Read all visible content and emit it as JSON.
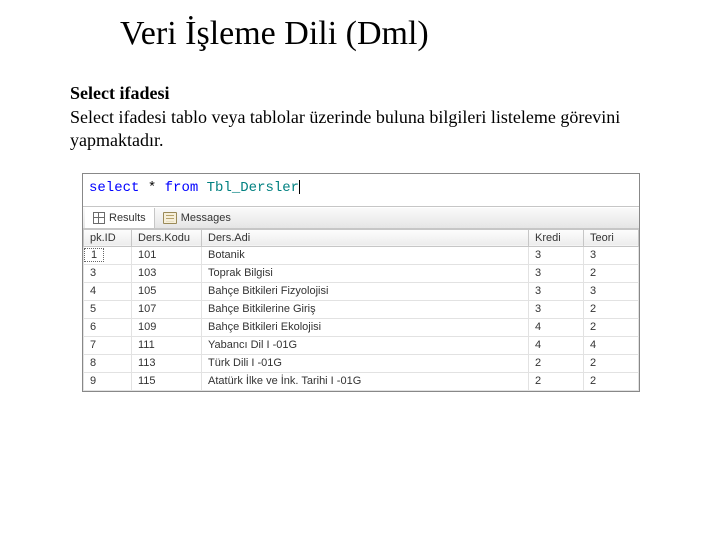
{
  "title": "Veri İşleme Dili (Dml)",
  "subtitle": "Select ifadesi",
  "body": "Select ifadesi tablo veya tablolar üzerinde buluna bilgileri listeleme görevini yapmaktadır.",
  "sql": {
    "kw_select": "select",
    "star": " * ",
    "kw_from": "from",
    "sp": " ",
    "table": "Tbl_Dersler"
  },
  "tabs": {
    "results": "Results",
    "messages": "Messages"
  },
  "columns": [
    "pk.ID",
    "Ders.Kodu",
    "Ders.Adi",
    "Kredi",
    "Teori"
  ],
  "rows": [
    {
      "id": "1",
      "kodu": "101",
      "adi": "Botanik",
      "kredi": "3",
      "teori": "3"
    },
    {
      "id": "3",
      "kodu": "103",
      "adi": "Toprak Bilgisi",
      "kredi": "3",
      "teori": "2"
    },
    {
      "id": "4",
      "kodu": "105",
      "adi": "Bahçe Bitkileri Fizyolojisi",
      "kredi": "3",
      "teori": "3"
    },
    {
      "id": "5",
      "kodu": "107",
      "adi": "Bahçe Bitkilerine Giriş",
      "kredi": "3",
      "teori": "2"
    },
    {
      "id": "6",
      "kodu": "109",
      "adi": "Bahçe Bitkileri Ekolojisi",
      "kredi": "4",
      "teori": "2"
    },
    {
      "id": "7",
      "kodu": "111",
      "adi": "Yabancı Dil I -01G",
      "kredi": "4",
      "teori": "4"
    },
    {
      "id": "8",
      "kodu": "113",
      "adi": "Türk Dili I -01G",
      "kredi": "2",
      "teori": "2"
    },
    {
      "id": "9",
      "kodu": "115",
      "adi": "Atatürk İlke ve İnk. Tarihi I -01G",
      "kredi": "2",
      "teori": "2"
    }
  ]
}
